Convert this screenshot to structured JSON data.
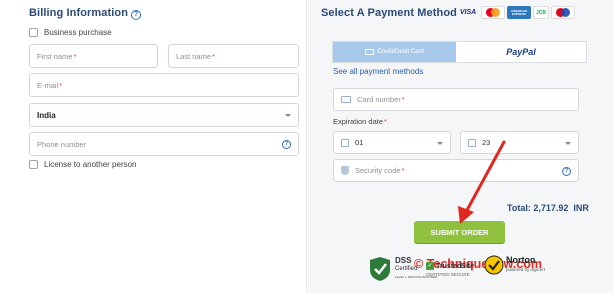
{
  "billing": {
    "title": "Billing Information",
    "business_purchase": "Business purchase",
    "first_name": "First name",
    "last_name": "Last name",
    "email": "E-mail",
    "country": "India",
    "phone": "Phone number",
    "license": "License to another person",
    "required_mark": "*"
  },
  "payment": {
    "title": "Select A Payment Method",
    "card_logos": [
      "VISA",
      "mastercard",
      "AMERICAN EXPRESS",
      "JCB",
      "maestro"
    ],
    "tab_card": "Credit/Debit Card",
    "tab_paypal": "PayPal",
    "see_all": "See all payment methods",
    "card_number": "Card number",
    "expiration_label": "Expiration date",
    "exp_month": "01",
    "exp_year": "23",
    "security_code": "Security code",
    "total": "Total: 2,717.92",
    "currency": "INR",
    "submit": "SUBMIT ORDER",
    "watermark": "© Techniquehow.com",
    "pci_line1": "DSS",
    "pci_line2": "Certified",
    "pci_sub": "LEVEL 1 SERVICE PROVIDER",
    "trusted_title": "TrustedSite",
    "trusted_sub": "CERTIFIED SECURE",
    "norton_title": "Norton",
    "norton_sub": "powered by digicert"
  },
  "colors": {
    "title_blue": "#2c4a7a",
    "submit_green": "#8fc13e",
    "arrow_red": "#e0281f",
    "tab_active": "#a9c9ec"
  }
}
